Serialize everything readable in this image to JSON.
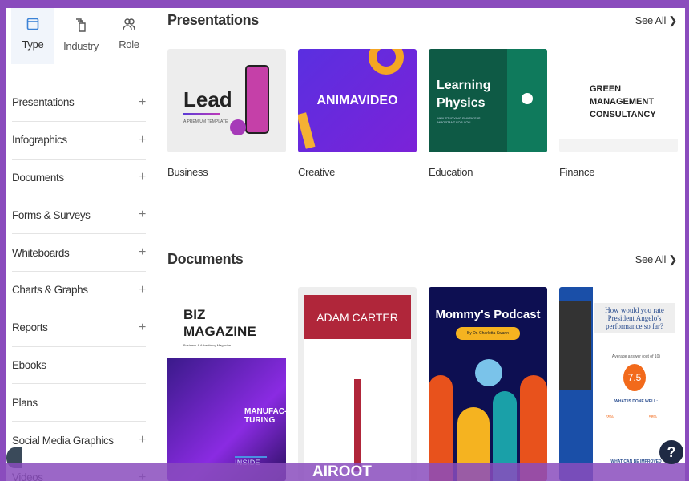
{
  "tabs": [
    {
      "label": "Type",
      "icon": "window-icon"
    },
    {
      "label": "Industry",
      "icon": "buildings-icon"
    },
    {
      "label": "Role",
      "icon": "users-icon"
    }
  ],
  "sidebar": {
    "items": [
      {
        "label": "Presentations",
        "plus": "+"
      },
      {
        "label": "Infographics",
        "plus": "+"
      },
      {
        "label": "Documents",
        "plus": "+"
      },
      {
        "label": "Forms & Surveys",
        "plus": "+"
      },
      {
        "label": "Whiteboards",
        "plus": "+"
      },
      {
        "label": "Charts & Graphs",
        "plus": "+"
      },
      {
        "label": "Reports",
        "plus": "+"
      },
      {
        "label": "Ebooks",
        "plus": ""
      },
      {
        "label": "Plans",
        "plus": ""
      },
      {
        "label": "Social Media Graphics",
        "plus": "+"
      },
      {
        "label": "Videos",
        "plus": "+"
      }
    ]
  },
  "presentations": {
    "title": "Presentations",
    "see_all": "See All ❯",
    "cards": [
      {
        "label": "Business",
        "thumb_title": "Lead",
        "thumb_sub": "A PREMIUM TEMPLATE"
      },
      {
        "label": "Creative",
        "thumb_title": "ANIMAVIDEO"
      },
      {
        "label": "Education",
        "thumb_title": "Learning Physics",
        "thumb_sub": "WHY STUDYING PHYSICS IS IMPORTANT FOR YOU"
      },
      {
        "label": "Finance",
        "thumb_title": "GREEN MANAGEMENT CONSULTANCY"
      }
    ]
  },
  "documents": {
    "title": "Documents",
    "see_all": "See All ❯",
    "cards": [
      {
        "thumb_title": "BIZ MAGAZINE",
        "thumb_sub": "Business & Advertising Magazine",
        "thumb_extra": "MANUFAC-TURING",
        "thumb_footer": "INSIDE"
      },
      {
        "thumb_title": "ADAM CARTER"
      },
      {
        "thumb_title": "Mommy's Podcast",
        "thumb_sub": "By Dr. Charlotta Swann"
      },
      {
        "thumb_title": "How would you rate President Angelo's performance so far?",
        "thumb_sub": "Average answer (out of 10)",
        "score": "7.5",
        "section": "WHAT IS DONE WELL:",
        "pct1": "65%",
        "pct2": "58%",
        "section2": "WHAT CAN BE IMPROVED"
      }
    ]
  },
  "watermark": "AIROOT",
  "help": "?",
  "colors": {
    "frame": "#8a4cbd",
    "accent": "#3b82d6"
  }
}
